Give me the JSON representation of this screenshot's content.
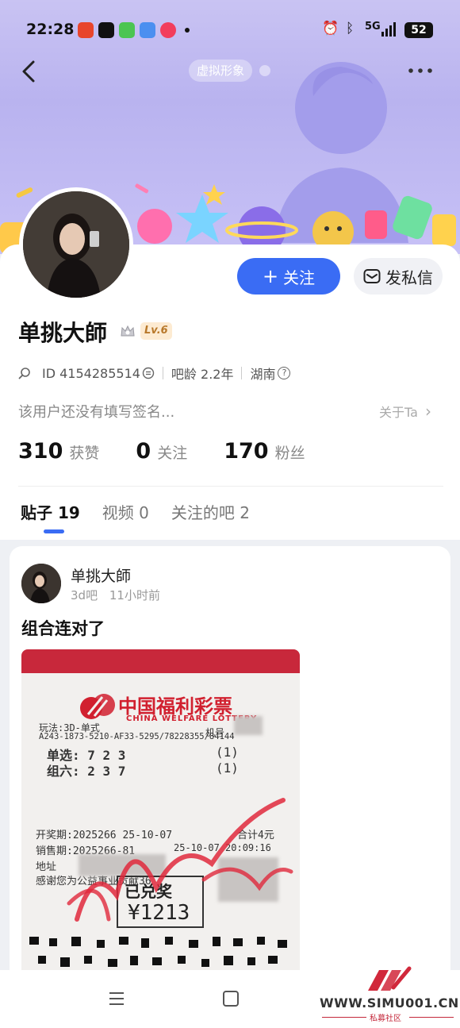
{
  "status_bar": {
    "time": "22:28",
    "battery": "52",
    "network": "5G"
  },
  "header": {
    "virtual_tag": "虚拟形象"
  },
  "profile": {
    "username": "单挑大師",
    "level": "Lv.6",
    "id_label": "ID 4154285514",
    "forum_age": "吧龄 2.2年",
    "location": "湖南",
    "signature": "该用户还没有填写签名...",
    "about_link": "关于Ta",
    "follow_button": "关注",
    "message_button": "发私信"
  },
  "stats": [
    {
      "value": "310",
      "label": "获赞"
    },
    {
      "value": "0",
      "label": "关注"
    },
    {
      "value": "170",
      "label": "粉丝"
    }
  ],
  "tabs": [
    {
      "label": "贴子 19",
      "active": true
    },
    {
      "label": "视频 0",
      "active": false
    },
    {
      "label": "关注的吧 2",
      "active": false
    }
  ],
  "post": {
    "author": "单挑大師",
    "forum": "3d吧",
    "time_ago": "11小时前",
    "title": "组合连对了",
    "ticket": {
      "title": "中国福利彩票",
      "subtitle": "CHINA WELFARE LOTTERY",
      "play_line": "玩法:3D-单式",
      "machine_label": "机号",
      "serial": "A243-1873-5210-AF33-5295/78228355/84144",
      "single_line": "单选: 7  2  3",
      "single_mult": "(1)",
      "group_line": "组六: 2  3  7",
      "group_mult": "(1)",
      "draw_line": "开奖期:2025266  25-10-07",
      "total_line": "合计4元",
      "sale_line": "销售期:2025266-81",
      "sale_time": "25-10-07 20:09:16",
      "address_line": "地址",
      "thanks_line": "感谢您为公益事业贡献36",
      "stamp_text": "已兑奖",
      "amount": "¥1213"
    }
  },
  "watermark": {
    "site": "WWW.SIMU001.CN",
    "subtitle": "私募社区"
  },
  "colors": {
    "accent": "#3a6cf4",
    "header_bg": "#c0baf2",
    "ticket_red": "#d1202f",
    "level_badge": "#fdebd2"
  },
  "icons": [
    "back-icon",
    "more-icon",
    "search-icon",
    "copy-icon",
    "question-icon",
    "crown-icon",
    "mail-icon",
    "plus-icon",
    "chevron-right-icon",
    "menu-icon",
    "home-icon"
  ]
}
